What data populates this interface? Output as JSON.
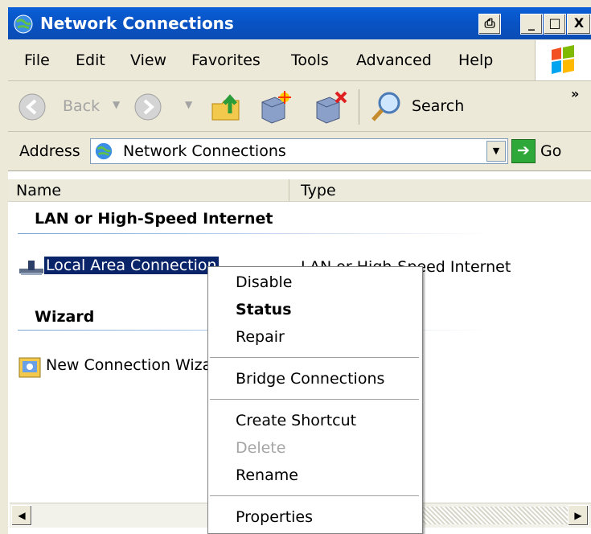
{
  "window": {
    "title": "Network Connections",
    "buttons": [
      "_",
      "□",
      "X"
    ]
  },
  "menubar": {
    "items": [
      "File",
      "Edit",
      "View",
      "Favorites",
      "Tools",
      "Advanced",
      "Help"
    ]
  },
  "toolbar": {
    "back_label": "Back",
    "search_label": "Search",
    "overflow": "»"
  },
  "address": {
    "label": "Address",
    "value": "Network Connections",
    "go_label": "Go"
  },
  "list": {
    "columns": [
      "Name",
      "Type"
    ],
    "groups": [
      {
        "title": "LAN or High-Speed Internet",
        "items": [
          {
            "name": "Local Area Connection",
            "type": "LAN or High-Speed Internet"
          }
        ]
      },
      {
        "title": "Wizard",
        "items": [
          {
            "name": "New Connection Wizard"
          }
        ]
      }
    ]
  },
  "context_menu": {
    "items": [
      {
        "label": "Disable",
        "style": "normal"
      },
      {
        "label": "Status",
        "style": "bold"
      },
      {
        "label": "Repair",
        "style": "normal"
      },
      {
        "label": "Bridge Connections",
        "style": "normal"
      },
      {
        "label": "Create Shortcut",
        "style": "normal"
      },
      {
        "label": "Delete",
        "style": "disabled"
      },
      {
        "label": "Rename",
        "style": "normal"
      },
      {
        "label": "Properties",
        "style": "normal"
      }
    ]
  },
  "colors": {
    "titlebar": "#0853c4",
    "selection": "#0a246a",
    "chrome": "#ece9d8"
  }
}
